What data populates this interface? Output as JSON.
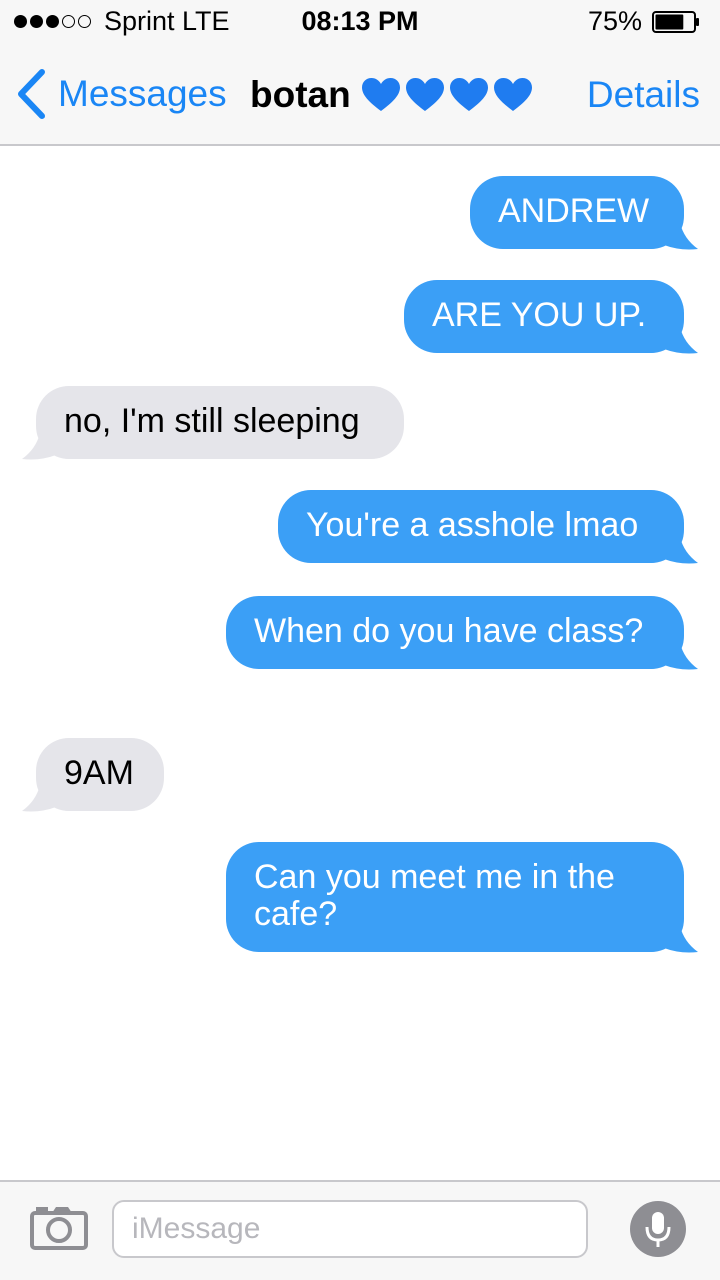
{
  "status_bar": {
    "signal_strength": "3/5",
    "carrier": "Sprint  LTE",
    "time": "08:13 PM",
    "battery_percent": "75%",
    "battery_level": 0.75
  },
  "nav": {
    "back_label": "Messages",
    "contact_name": "botan",
    "contact_emoji": [
      "💙",
      "💙",
      "💙",
      "💙"
    ],
    "details_label": "Details"
  },
  "messages": [
    {
      "direction": "sent",
      "text": "ANDREW"
    },
    {
      "direction": "sent",
      "text": "ARE YOU UP."
    },
    {
      "direction": "received",
      "text": "no, I'm still sleeping"
    },
    {
      "direction": "sent",
      "text": "You're a asshole lmao"
    },
    {
      "direction": "sent",
      "text": "When do you have class?"
    },
    {
      "direction": "received",
      "text": "9AM"
    },
    {
      "direction": "sent",
      "text": "Can you meet me in the cafe?"
    }
  ],
  "input_bar": {
    "placeholder": "iMessage",
    "camera_icon": "camera-icon",
    "mic_icon": "microphone-icon"
  },
  "colors": {
    "accent": "#1a86f5",
    "sent_bubble": "#3b9ff6",
    "received_bubble": "#e5e5ea",
    "heart": "#1f7cf0"
  }
}
